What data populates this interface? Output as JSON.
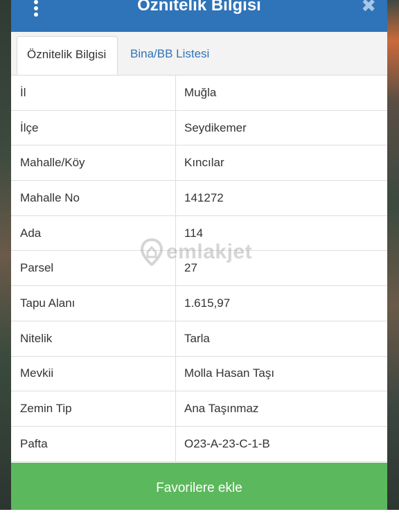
{
  "dialog": {
    "title": "Öznitelik Bilgisi"
  },
  "tabs": [
    {
      "label": "Öznitelik Bilgisi",
      "active": true
    },
    {
      "label": "Bina/BB Listesi",
      "active": false
    }
  ],
  "rows": [
    {
      "label": "İl",
      "value": "Muğla"
    },
    {
      "label": "İlçe",
      "value": "Seydikemer"
    },
    {
      "label": "Mahalle/Köy",
      "value": "Kıncılar"
    },
    {
      "label": "Mahalle No",
      "value": "141272"
    },
    {
      "label": "Ada",
      "value": "114"
    },
    {
      "label": "Parsel",
      "value": "27"
    },
    {
      "label": "Tapu Alanı",
      "value": "1.615,97"
    },
    {
      "label": "Nitelik",
      "value": "Tarla"
    },
    {
      "label": "Mevkii",
      "value": "Molla Hasan Taşı"
    },
    {
      "label": "Zemin Tip",
      "value": "Ana Taşınmaz"
    },
    {
      "label": "Pafta",
      "value": "O23-A-23-C-1-B"
    }
  ],
  "watermark": {
    "text": "emlakjet"
  },
  "footer": {
    "button_label": "Favorilere ekle"
  },
  "colors": {
    "header": "#2f73b8",
    "tab_link": "#2f73b8",
    "button": "#5cb85c"
  },
  "icons": {
    "menu": "vertical-dots-icon",
    "close": "close-icon",
    "watermark": "location-pin-icon"
  }
}
